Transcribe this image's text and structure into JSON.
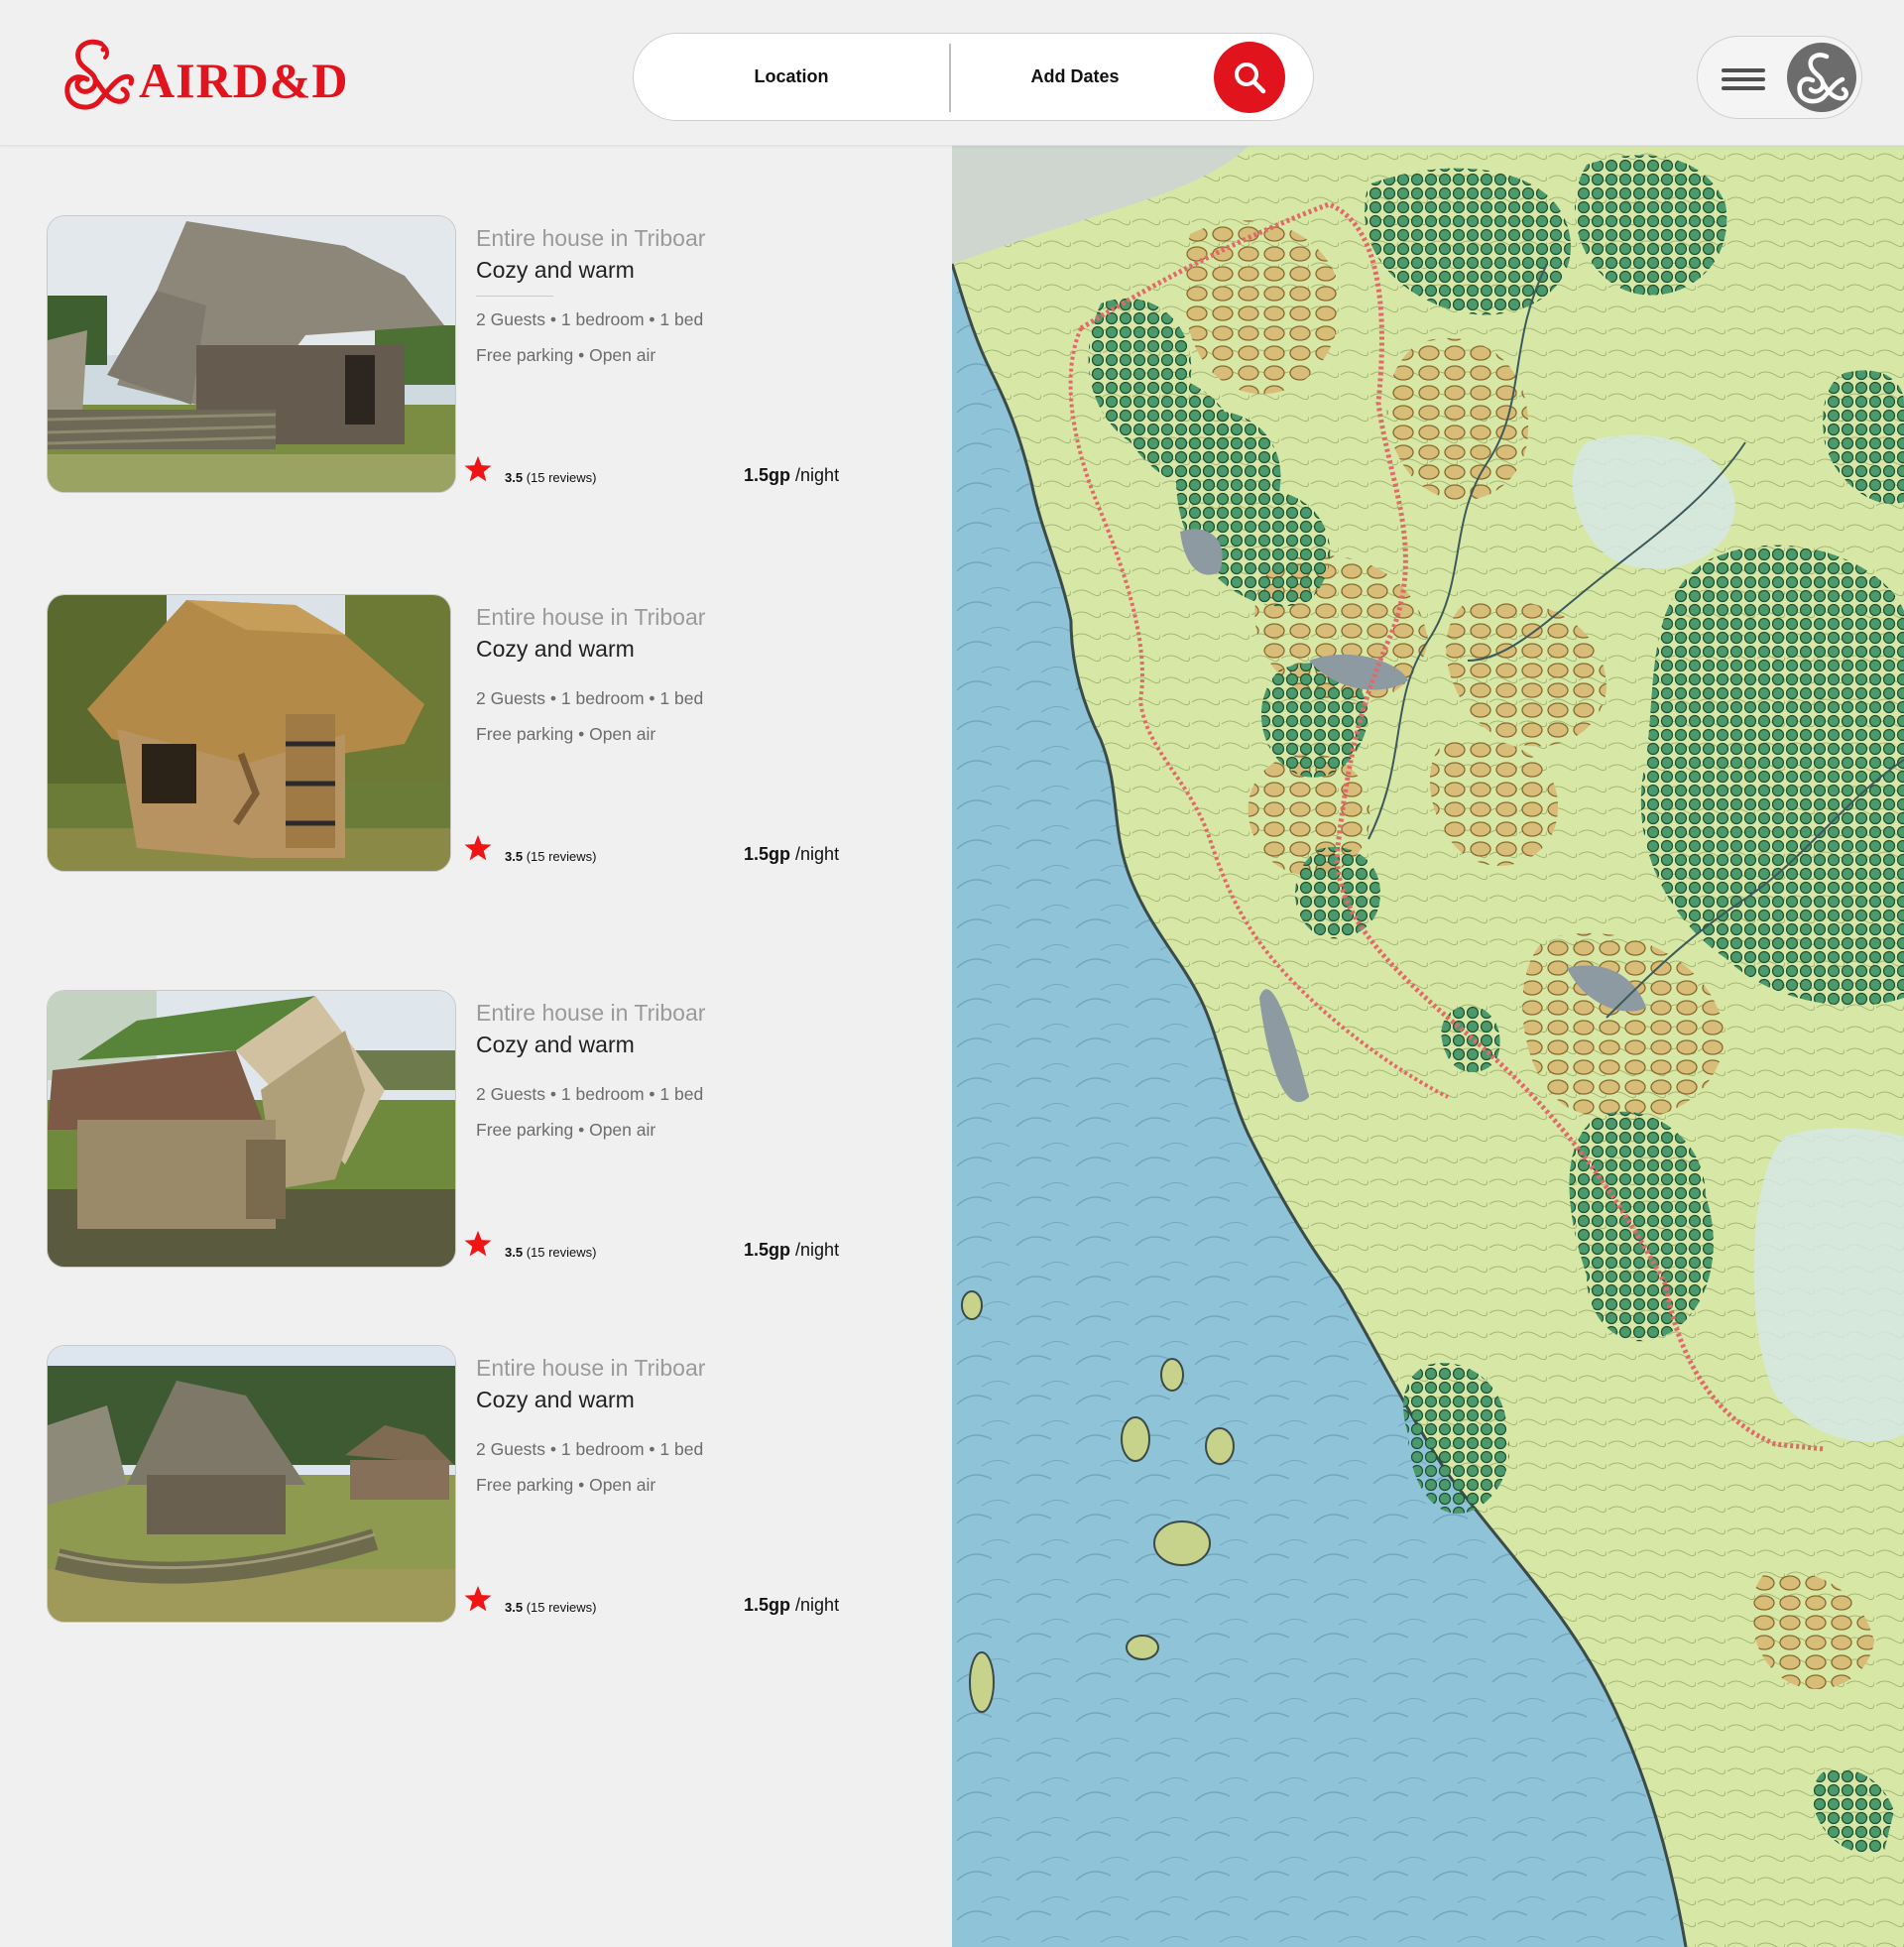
{
  "brand": {
    "name": "AIRD&D",
    "logo_icon": "ampersand-dragon-logo",
    "color": "#e1131c"
  },
  "search": {
    "location_label": "Location",
    "dates_label": "Add Dates",
    "button_icon": "search-icon"
  },
  "user_menu": {
    "menu_icon": "hamburger-icon",
    "avatar_icon": "ampersand-avatar"
  },
  "listings": [
    {
      "type": "Entire house in Triboar",
      "name": "Cozy and warm",
      "specs": "2 Guests • 1 bedroom •  1 bed",
      "amenities": "Free parking • Open air",
      "rating": "3.5",
      "reviews": "(15 reviews)",
      "price": "1.5gp",
      "per": "/night",
      "photo": "longhouse-with-wattle-fence"
    },
    {
      "type": "Entire house in Triboar",
      "name": "Cozy and warm",
      "specs": "2 Guests • 1 bedroom •  1 bed",
      "amenities": "Free parking • Open air",
      "rating": "3.5",
      "reviews": "(15 reviews)",
      "price": "1.5gp",
      "per": "/night",
      "photo": "round-thatched-hut"
    },
    {
      "type": "Entire house in Triboar",
      "name": "Cozy and warm",
      "specs": "2 Guests • 1 bedroom •  1 bed",
      "amenities": "Free parking • Open air",
      "rating": "3.5",
      "reviews": "(15 reviews)",
      "price": "1.5gp",
      "per": "/night",
      "photo": "turf-roofed-hut"
    },
    {
      "type": "Entire house in Triboar",
      "name": "Cozy and warm",
      "specs": "2 Guests • 1 bedroom •  1 bed",
      "amenities": "Free parking • Open air",
      "rating": "3.5",
      "reviews": "(15 reviews)",
      "price": "1.5gp",
      "per": "/night",
      "photo": "village-of-thatched-huts"
    }
  ],
  "map": {
    "style": "illustrated-fantasy-map",
    "colors": {
      "sea": "#8fc3d8",
      "land": "#d7e7a6",
      "forest": "#3f8f62",
      "hills": "#c9ab62",
      "route": "#e06a6a"
    }
  }
}
